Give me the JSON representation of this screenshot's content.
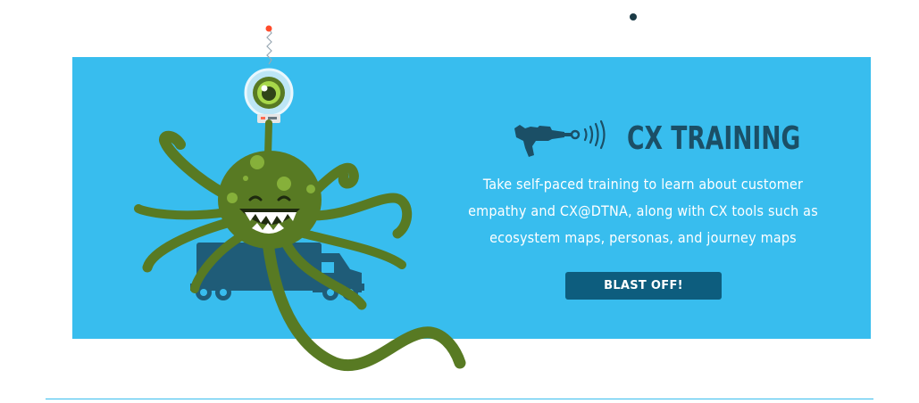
{
  "colors": {
    "banner_bg": "#38bdee",
    "title": "#1b4f66",
    "button_bg": "#0d5d7e",
    "octopus": "#587a23",
    "truck": "#1f5c78"
  },
  "icons": {
    "title_icon": "ray-gun-icon",
    "mascot": "octopus-alien-illustration"
  },
  "training": {
    "title": "CX TRAINING",
    "description": "Take self-paced training to learn about customer empathy and CX@DTNA, along with CX tools such as ecosystem maps, personas, and journey maps",
    "button_label": "BLAST OFF!"
  }
}
